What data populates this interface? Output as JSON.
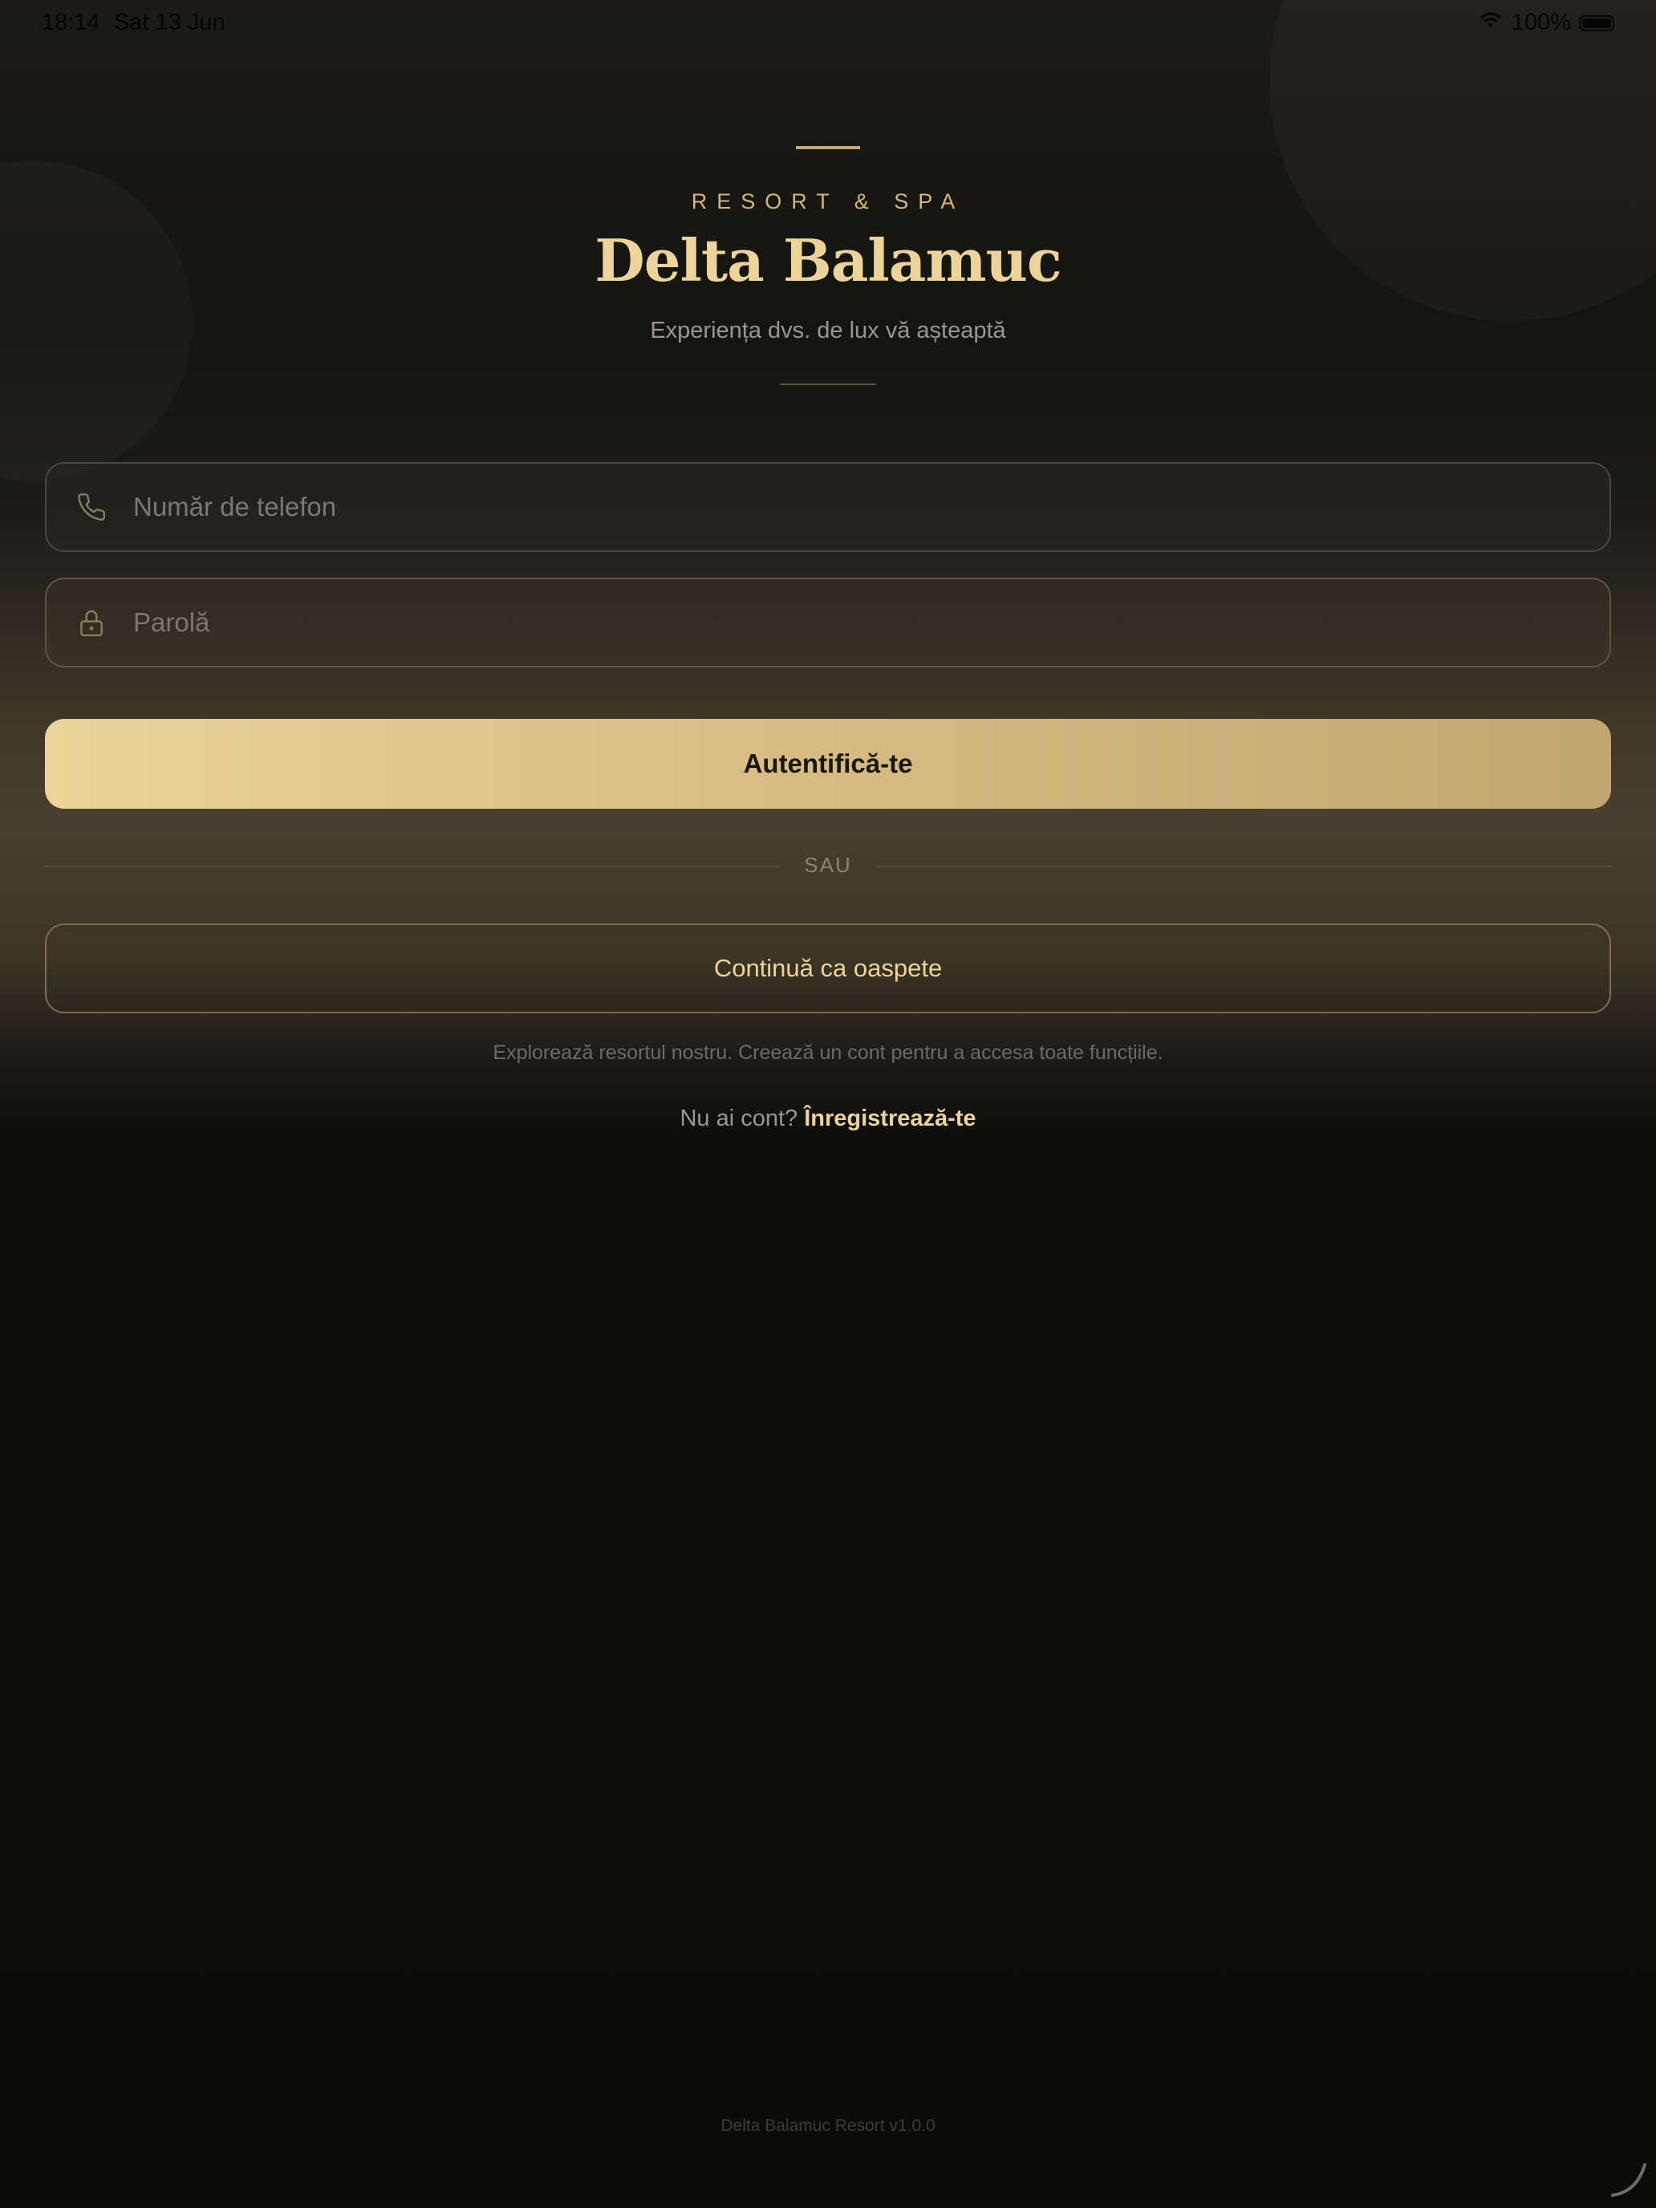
{
  "status_bar": {
    "time": "18:14",
    "date": "Sat 13 Jun",
    "battery": "100%",
    "wifi_icon": "wifi-icon",
    "battery_icon": "battery-icon"
  },
  "header": {
    "eyebrow": "RESORT & SPA",
    "title": "Delta Balamuc",
    "tagline": "Experiența dvs. de lux vă așteaptă"
  },
  "form": {
    "phone": {
      "placeholder": "Număr de telefon",
      "value": "",
      "icon": "phone-icon"
    },
    "password": {
      "placeholder": "Parolă",
      "value": "",
      "icon": "lock-icon"
    },
    "submit_label": "Autentifică-te"
  },
  "divider_label": "SAU",
  "guest": {
    "button_label": "Continuă ca oaspete",
    "note": "Explorează resortul nostru. Creează un cont pentru a accesa toate funcțiile."
  },
  "register": {
    "prompt": "Nu ai cont?",
    "link_label": "Înregistrează-te"
  },
  "footer": {
    "version": "Delta Balamuc Resort v1.0.0"
  },
  "colors": {
    "accent_gold": "#ebd39a",
    "button_gradient_start": "#ead497",
    "button_gradient_end": "#c2a66f",
    "background": "#0c0c0a"
  }
}
